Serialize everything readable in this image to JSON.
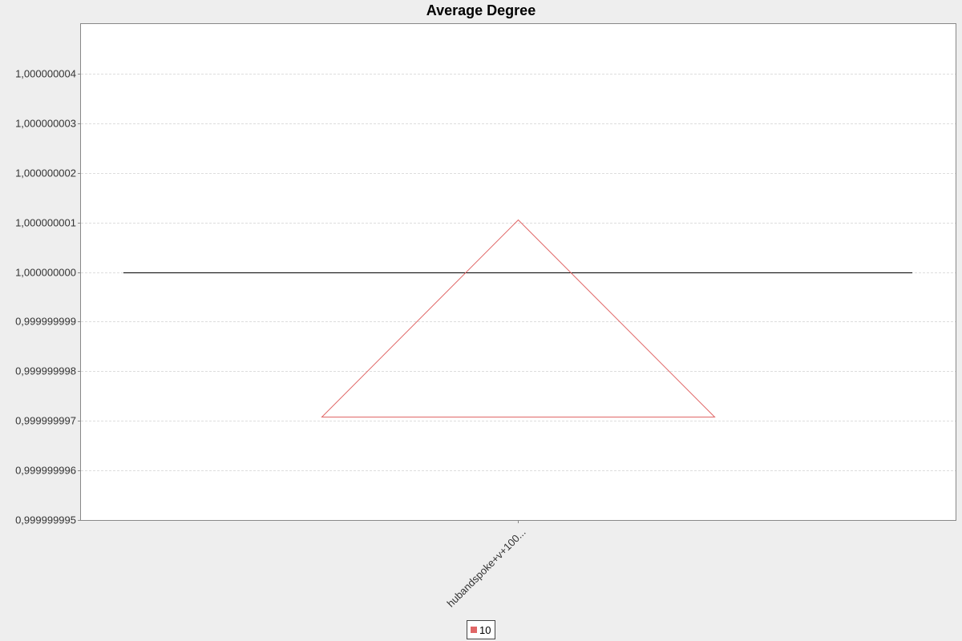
{
  "chart_data": {
    "type": "line",
    "title": "Average Degree",
    "xlabel": "",
    "ylabel": "",
    "categories": [
      "hubandspoke+v+100..."
    ],
    "ylim": [
      0.999999995,
      1.000000005
    ],
    "yticks": [
      0.999999995,
      0.999999996,
      0.999999997,
      0.999999998,
      0.999999999,
      1.0,
      1.000000001,
      1.000000002,
      1.000000003,
      1.000000004
    ],
    "ytick_labels": [
      "0,999999995",
      "0,999999996",
      "0,999999997",
      "0,999999998",
      "0,999999999",
      "1,000000000",
      "1,000000001",
      "1,000000002",
      "1,000000003",
      "1,000000004"
    ],
    "grid": true,
    "legend_position": "bottom-center",
    "series": [
      {
        "name": "10",
        "color": "#e06666",
        "values": [
          1.0
        ],
        "marker": "triangle-outline"
      }
    ],
    "reference_line": {
      "value": 1.0,
      "color": "#000000"
    }
  },
  "colors": {
    "background": "#eeeeee",
    "plot_background": "#ffffff",
    "plot_border": "#888888",
    "gridline": "#dddddd"
  }
}
